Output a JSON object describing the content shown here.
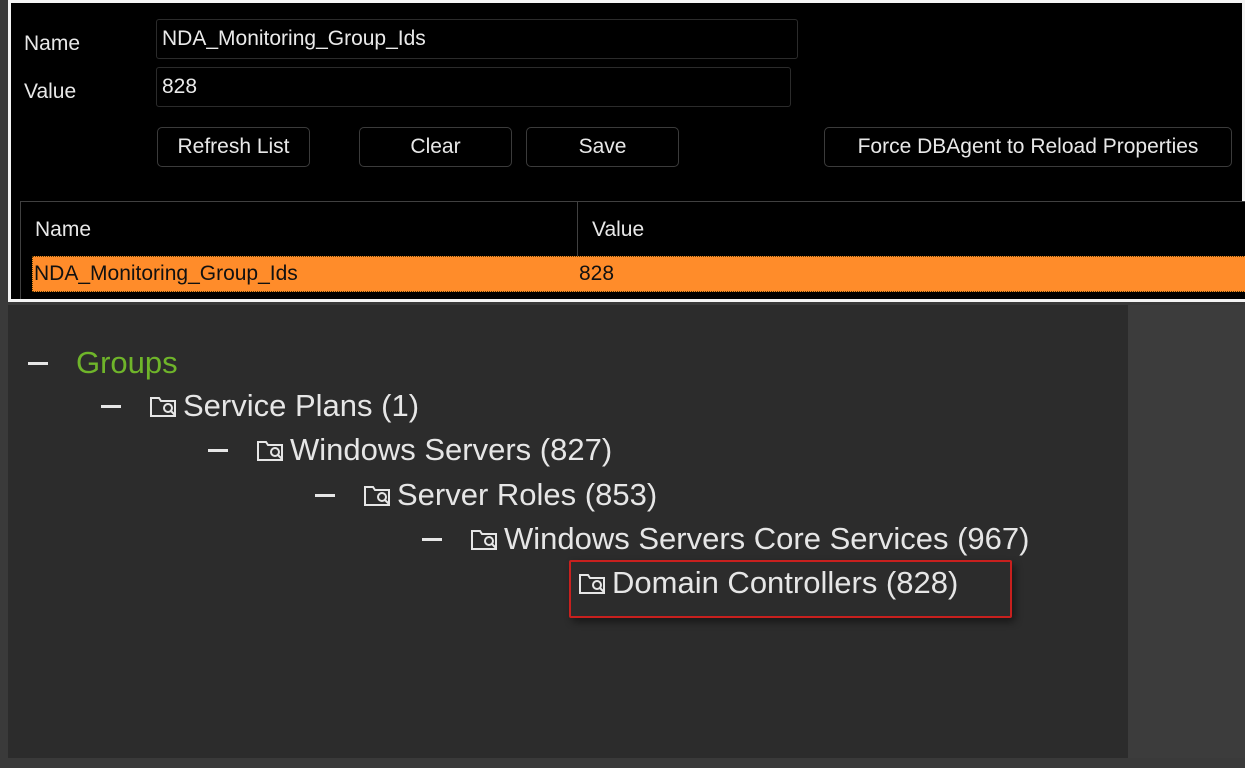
{
  "form": {
    "name_label": "Name",
    "name_value": "NDA_Monitoring_Group_Ids",
    "value_label": "Value",
    "value_value": "828"
  },
  "buttons": {
    "refresh": "Refresh List",
    "clear": "Clear",
    "save": "Save",
    "force_reload": "Force DBAgent to Reload Properties"
  },
  "table": {
    "columns": [
      "Name",
      "Value"
    ],
    "rows": [
      {
        "name": "NDA_Monitoring_Group_Ids",
        "value": "828",
        "selected": true
      }
    ]
  },
  "tree": {
    "root": "Groups",
    "nodes": [
      "Service Plans (1)",
      "Windows Servers (827)",
      "Server Roles (853)",
      "Windows Servers Core Services (967)",
      "Domain Controllers (828)"
    ],
    "icon": "folder-search-icon"
  },
  "colors": {
    "selected_row": "#ff8c2a",
    "root_label": "#6fb52a",
    "highlight_border": "#c8201e"
  }
}
